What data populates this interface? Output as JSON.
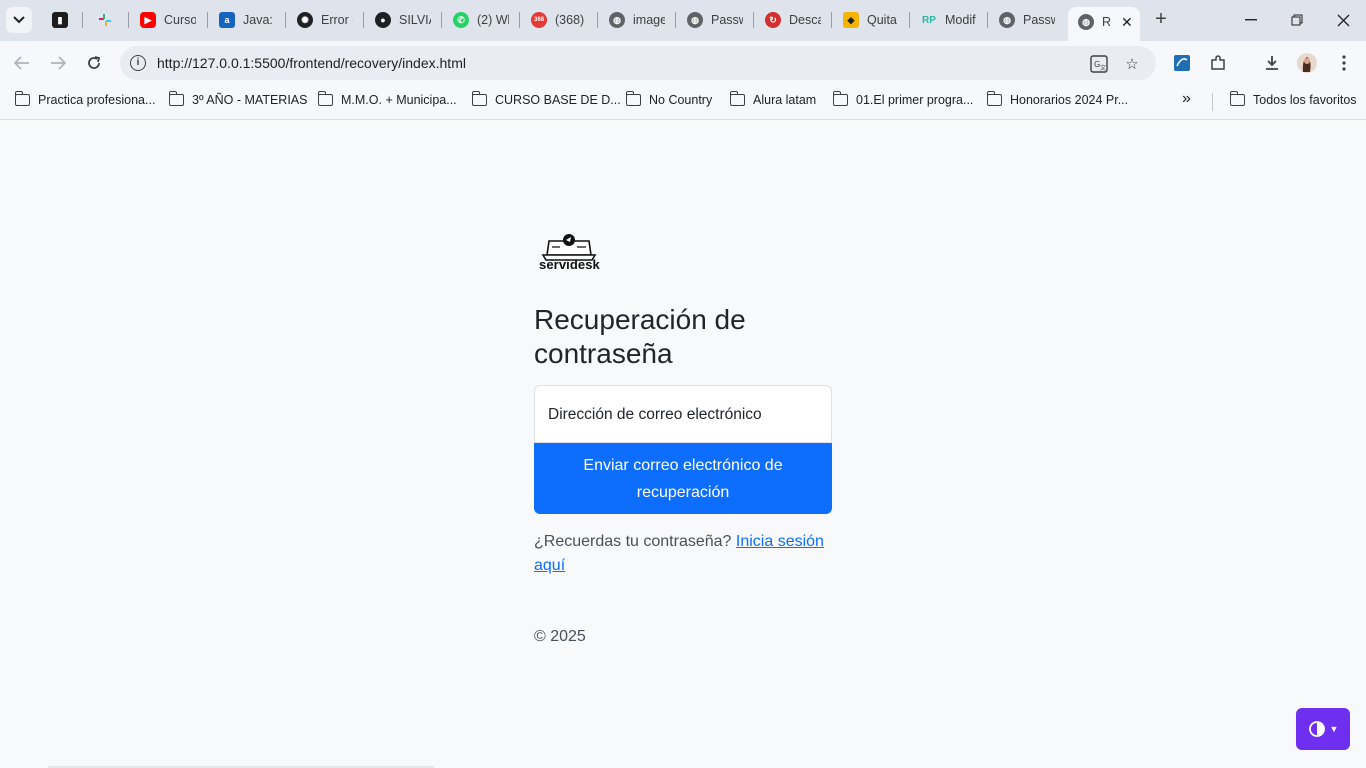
{
  "browser": {
    "tabs": [
      {
        "title": "",
        "favicon": "trello-icon"
      },
      {
        "title": "",
        "favicon": "slack-icon"
      },
      {
        "title": "Curso",
        "favicon": "youtube-icon"
      },
      {
        "title": "Java: c",
        "favicon": "alura-icon"
      },
      {
        "title": "Error -",
        "favicon": "chatgpt-icon"
      },
      {
        "title": "SILVIA",
        "favicon": "github-icon"
      },
      {
        "title": "(2) Wl",
        "favicon": "whatsapp-icon"
      },
      {
        "title": "(368)",
        "favicon": "notification-icon",
        "badge": "368"
      },
      {
        "title": "image",
        "favicon": "globe-icon"
      },
      {
        "title": "Passw",
        "favicon": "globe-icon"
      },
      {
        "title": "Desca",
        "favicon": "download-site-icon"
      },
      {
        "title": "Quita",
        "favicon": "graduation-icon"
      },
      {
        "title": "Modif",
        "favicon": "rp-icon"
      },
      {
        "title": "Passw",
        "favicon": "globe-icon"
      }
    ],
    "active_tab": {
      "title": "R",
      "favicon": "globe-icon"
    },
    "url": "http://127.0.0.1:5500/frontend/recovery/index.html",
    "bookmarks": [
      "Practica profesiona...",
      "3º AÑO - MATERIAS",
      "M.M.O. + Municipa...",
      "CURSO BASE DE D...",
      "No Country",
      "Alura latam",
      "01.El primer progra...",
      "Honorarios 2024 Pr..."
    ],
    "all_bookmarks_label": "Todos los favoritos",
    "overflow_label": "»"
  },
  "page": {
    "logo_text": "servidesk",
    "heading": "Recuperación de contraseña",
    "email_label": "Dirección de correo electrónico",
    "submit_label": "Enviar correo electrónico de recuperación",
    "recall_text": "¿Recuerdas tu contraseña?",
    "login_link": "Inicia sesión aquí",
    "copyright": "© 2025",
    "theme_toggle_icon": "contrast-icon"
  },
  "colors": {
    "primary": "#0d6efd",
    "theme_toggle": "#6f2ff0",
    "background": "#f8f9fa"
  }
}
